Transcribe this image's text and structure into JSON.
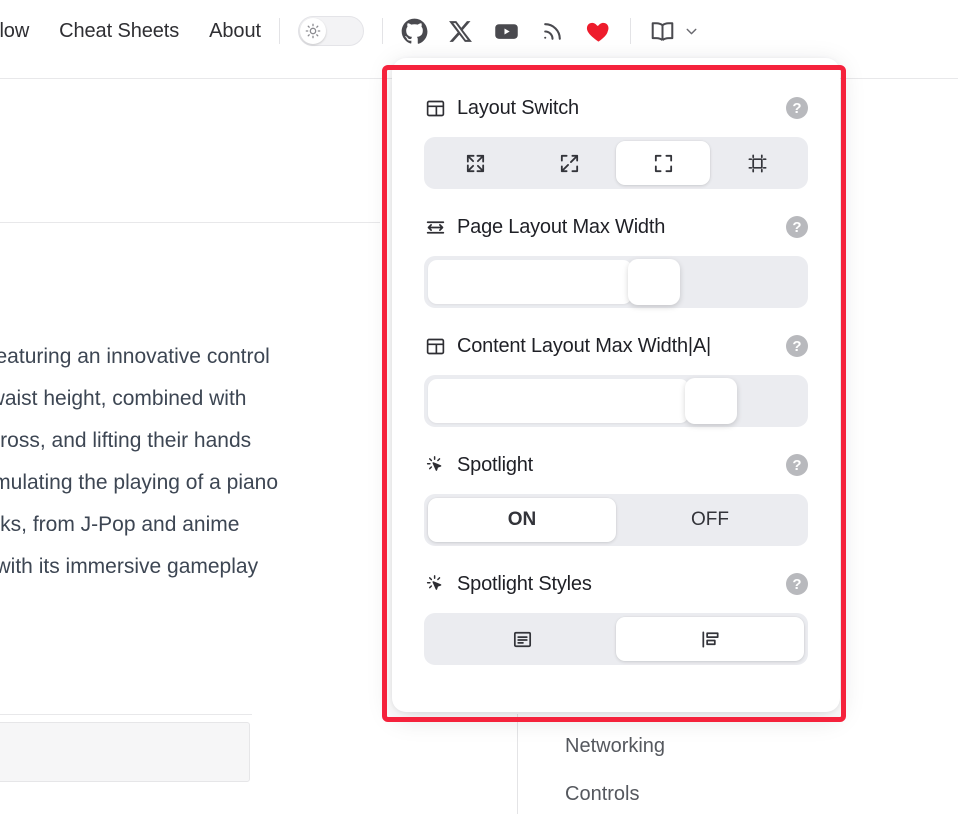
{
  "topnav": {
    "links": [
      {
        "label": "flow",
        "name": "nav-link-flow"
      },
      {
        "label": "Cheat Sheets",
        "name": "nav-link-cheat-sheets"
      },
      {
        "label": "About",
        "name": "nav-link-about"
      }
    ],
    "theme_toggle": {
      "icon": "sun-icon",
      "state": "light"
    },
    "social": [
      {
        "name": "github-icon",
        "label": "GitHub"
      },
      {
        "name": "x-twitter-icon",
        "label": "X"
      },
      {
        "name": "youtube-icon",
        "label": "YouTube"
      },
      {
        "name": "rss-icon",
        "label": "RSS"
      },
      {
        "name": "heart-icon",
        "label": "Sponsor",
        "color": "#ee1c2c"
      }
    ],
    "book_menu": {
      "icon": "book-icon",
      "chevron": "chevron-down-icon"
    }
  },
  "background": {
    "paragraph_lines": [
      ", featuring an innovative control",
      "t waist height, combined with",
      "across, and lifting their hands",
      "simulating the playing of a piano",
      "acks, from J-Pop and anime",
      "e with its immersive gameplay"
    ],
    "toc_items": [
      {
        "label": "Networking"
      },
      {
        "label": "Controls"
      }
    ]
  },
  "highlight": {
    "color": "#f5223c"
  },
  "panel": {
    "sections": [
      {
        "id": "layout-switch",
        "icon": "layout-panel-icon",
        "title": "Layout Switch",
        "help": "?",
        "control": "segmented-icons",
        "options": [
          {
            "icon": "arrows-maximize-icon",
            "selected": false
          },
          {
            "icon": "expand-diagonal-icon",
            "selected": false
          },
          {
            "icon": "corners-frame-icon",
            "selected": true
          },
          {
            "icon": "crop-frame-icon",
            "selected": false
          }
        ]
      },
      {
        "id": "page-layout-max-width",
        "icon": "arrows-horizontal-icon",
        "title": "Page Layout Max Width",
        "help": "?",
        "control": "slider",
        "value_percent": 57
      },
      {
        "id": "content-layout-max-width",
        "icon": "layout-panel-icon",
        "title": "Content Layout Max Width|A|",
        "help": "?",
        "control": "slider",
        "value_percent": 72
      },
      {
        "id": "spotlight",
        "icon": "spotlight-cursor-icon",
        "title": "Spotlight",
        "help": "?",
        "control": "segmented-text",
        "options": [
          {
            "label": "ON",
            "selected": true
          },
          {
            "label": "OFF",
            "selected": false
          }
        ]
      },
      {
        "id": "spotlight-styles",
        "icon": "spotlight-cursor-icon",
        "title": "Spotlight Styles",
        "help": "?",
        "control": "segmented-icons",
        "options": [
          {
            "icon": "text-block-boxed-icon",
            "selected": false
          },
          {
            "icon": "text-lines-bar-icon",
            "selected": true
          }
        ]
      }
    ]
  }
}
